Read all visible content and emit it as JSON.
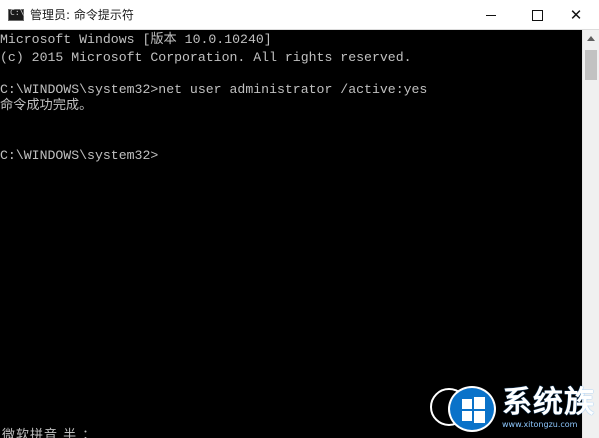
{
  "window": {
    "title": "管理员: 命令提示符",
    "icon": "cmd-icon",
    "icon_glyph": "C:\\",
    "buttons": {
      "minimize": "minimize-icon",
      "maximize": "maximize-icon",
      "close": "✕"
    }
  },
  "console": {
    "lines": [
      "Microsoft Windows [版本 10.0.10240]",
      "(c) 2015 Microsoft Corporation. All rights reserved.",
      "C:\\WINDOWS\\system32>net user administrator /active:yes",
      "命令成功完成。",
      "C:\\WINDOWS\\system32>"
    ],
    "ime_status": "微软拼音 半 ："
  },
  "watermark": {
    "text": "系统族",
    "url": "www.xitongzu.com"
  },
  "colors": {
    "console_bg": "#000000",
    "console_fg": "#c0c0c0",
    "titlebar_bg": "#ffffff",
    "logo_blue": "#0a72c9"
  }
}
